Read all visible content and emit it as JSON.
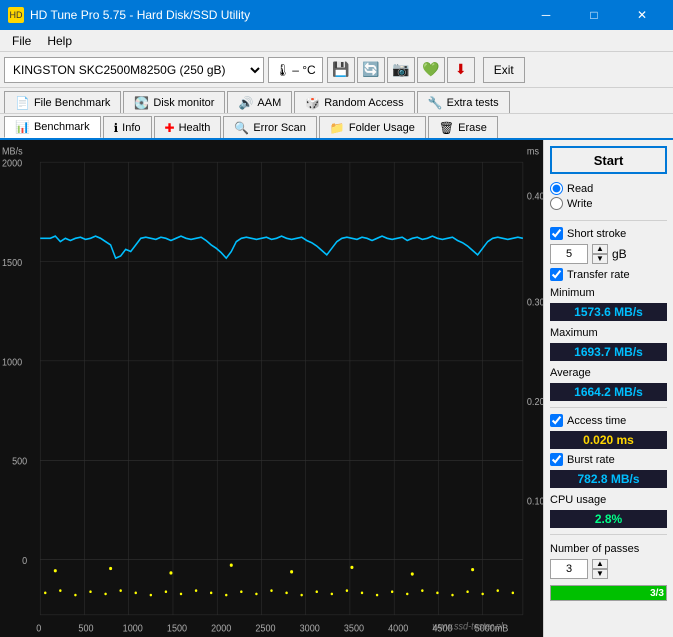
{
  "titleBar": {
    "title": "HD Tune Pro 5.75 - Hard Disk/SSD Utility",
    "minBtn": "─",
    "maxBtn": "□",
    "closeBtn": "✕"
  },
  "menu": {
    "items": [
      "File",
      "Help"
    ]
  },
  "toolbar": {
    "driveValue": "KINGSTON SKC2500M8250G (250 gB)",
    "temp": "– °C",
    "exitLabel": "Exit"
  },
  "tabs": {
    "row1": [
      {
        "label": "File Benchmark",
        "icon": "📄"
      },
      {
        "label": "Disk monitor",
        "icon": "💽"
      },
      {
        "label": "AAM",
        "icon": "🔊"
      },
      {
        "label": "Random Access",
        "icon": "🎲"
      },
      {
        "label": "Extra tests",
        "icon": "🔧"
      }
    ],
    "row2": [
      {
        "label": "Benchmark",
        "icon": "📊",
        "active": true
      },
      {
        "label": "Info",
        "icon": "ℹ"
      },
      {
        "label": "Health",
        "icon": "❤"
      },
      {
        "label": "Error Scan",
        "icon": "🔍"
      },
      {
        "label": "Folder Usage",
        "icon": "📁"
      },
      {
        "label": "Erase",
        "icon": "🗑"
      }
    ]
  },
  "chart": {
    "yAxisLeft": {
      "label": "MB/s",
      "values": [
        "2000",
        "1500",
        "1000",
        "500",
        ""
      ]
    },
    "yAxisRight": {
      "label": "ms",
      "values": [
        "0.40",
        "0.30",
        "0.20",
        "0.10",
        ""
      ]
    },
    "xAxis": {
      "values": [
        "0",
        "500",
        "1000",
        "1500",
        "2000",
        "2500",
        "3000",
        "3500",
        "4000",
        "4500",
        "5000mB"
      ]
    },
    "lineColor": "#00bfff",
    "dotColor": "#ffff00",
    "avgLineY": 1664.2,
    "minY": 0,
    "maxY": 2000
  },
  "rightPanel": {
    "startLabel": "Start",
    "readLabel": "Read",
    "writeLabel": "Write",
    "shortStrokeLabel": "Short stroke",
    "shortStrokeValue": "5",
    "shortStrokeUnit": "gB",
    "transferRateLabel": "Transfer rate",
    "minimumLabel": "Minimum",
    "minimumValue": "1573.6 MB/s",
    "maximumLabel": "Maximum",
    "maximumValue": "1693.7 MB/s",
    "averageLabel": "Average",
    "averageValue": "1664.2 MB/s",
    "accessTimeLabel": "Access time",
    "accessTimeChecked": true,
    "accessTimeValue": "0.020 ms",
    "burstRateLabel": "Burst rate",
    "burstRateChecked": true,
    "burstRateValue": "782.8 MB/s",
    "cpuUsageLabel": "CPU usage",
    "cpuUsageValue": "2.8%",
    "passesLabel": "Number of passes",
    "passesValue": "3",
    "progressLabel": "3/3",
    "progressPercent": 100
  },
  "watermark": "www.ssd-tester.pl"
}
